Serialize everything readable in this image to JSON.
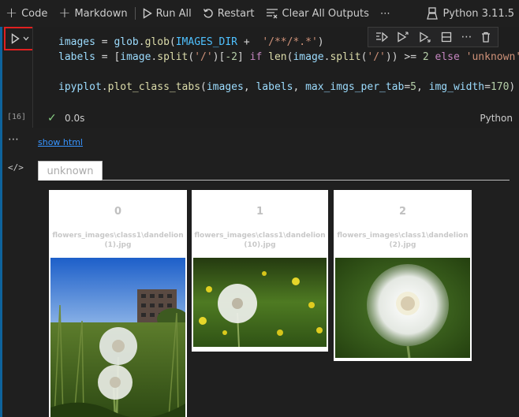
{
  "toolbar": {
    "code_label": "Code",
    "markdown_label": "Markdown",
    "run_all_label": "Run All",
    "restart_label": "Restart",
    "clear_outputs_label": "Clear All Outputs",
    "more_label": "⋯",
    "kernel_label": "Python 3.11.5"
  },
  "cell": {
    "execution_count": "[16]",
    "status_time": "0.0s",
    "language": "Python",
    "code": {
      "l1_a": "images",
      "l1_b": " = ",
      "l1_c": "glob",
      "l1_d": ".",
      "l1_e": "glob",
      "l1_f": "(",
      "l1_g": "IMAGES_DIR",
      "l1_h": " +  ",
      "l1_i": "'/**/*.*'",
      "l1_j": ")",
      "l2_a": "labels",
      "l2_b": " = [",
      "l2_c": "image",
      "l2_d": ".",
      "l2_e": "split",
      "l2_f": "(",
      "l2_g": "'/'",
      "l2_h": ")[",
      "l2_i": "-2",
      "l2_j": "] ",
      "l2_k": "if",
      "l2_l": " ",
      "l2_m": "len",
      "l2_n": "(",
      "l2_o": "image",
      "l2_p": ".",
      "l2_q": "split",
      "l2_r": "(",
      "l2_s": "'/'",
      "l2_t": ")) >= ",
      "l2_u": "2",
      "l2_v": " ",
      "l2_w": "else",
      "l2_x": " ",
      "l2_y": "'unknown'",
      "l4_a": "ipyplot",
      "l4_b": ".",
      "l4_c": "plot_class_tabs",
      "l4_d": "(",
      "l4_e": "images",
      "l4_f": ", ",
      "l4_g": "labels",
      "l4_h": ", ",
      "l4_i": "max_imgs_per_tab",
      "l4_j": "=",
      "l4_k": "5",
      "l4_l": ", ",
      "l4_m": "img_width",
      "l4_n": "=",
      "l4_o": "170",
      "l4_p": ")"
    }
  },
  "output": {
    "show_html_label": "show html",
    "tabs": [
      {
        "label": "unknown"
      }
    ],
    "cards": [
      {
        "index": "0",
        "name_line1": "flowers_images\\class1\\dandelion",
        "name_line2": "(1).jpg"
      },
      {
        "index": "1",
        "name_line1": "flowers_images\\class1\\dandelion",
        "name_line2": "(10).jpg"
      },
      {
        "index": "2",
        "name_line1": "flowers_images\\class1\\dandelion",
        "name_line2": "(2).jpg"
      }
    ]
  },
  "colors": {
    "accent": "#0e639c",
    "highlight_border": "#e02020",
    "link": "#3794ff",
    "success": "#89d185"
  },
  "icons": [
    "plus-icon",
    "play-icon",
    "restart-icon",
    "clear-outputs-icon",
    "more-icon",
    "kernel-icon",
    "chevron-down-icon",
    "run-by-line-icon",
    "execute-above-icon",
    "execute-below-icon",
    "split-cell-icon",
    "delete-icon",
    "check-icon",
    "code-icon"
  ]
}
